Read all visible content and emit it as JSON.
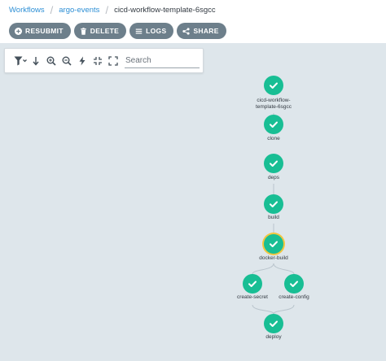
{
  "breadcrumb": {
    "workflows": "Workflows",
    "namespace": "argo-events",
    "current": "cicd-workflow-template-6sgcc",
    "separator": "/"
  },
  "actions": {
    "resubmit": "RESUBMIT",
    "delete": "DELETE",
    "logs": "LOGS",
    "share": "SHARE"
  },
  "toolbar": {
    "search_placeholder": "Search",
    "icons": [
      "filter-icon",
      "sort-direction-icon",
      "zoom-in-icon",
      "zoom-out-icon",
      "fast-mode-icon",
      "shrink-icon",
      "expand-icon"
    ]
  },
  "graph": {
    "nodes": {
      "root": "cicd-workflow-template-6sgcc",
      "clone": "clone",
      "deps": "deps",
      "build": "build",
      "docker_build": "docker-build",
      "create_secret": "create-secret",
      "create_config": "create-config",
      "deploy": "deploy"
    },
    "status": "succeeded",
    "selected": "docker-build"
  },
  "colors": {
    "success": "#18be94",
    "selected_ring": "#f3c63f",
    "button": "#6d7f8b",
    "canvas": "#dee6eb",
    "link": "#2d8fd5"
  }
}
